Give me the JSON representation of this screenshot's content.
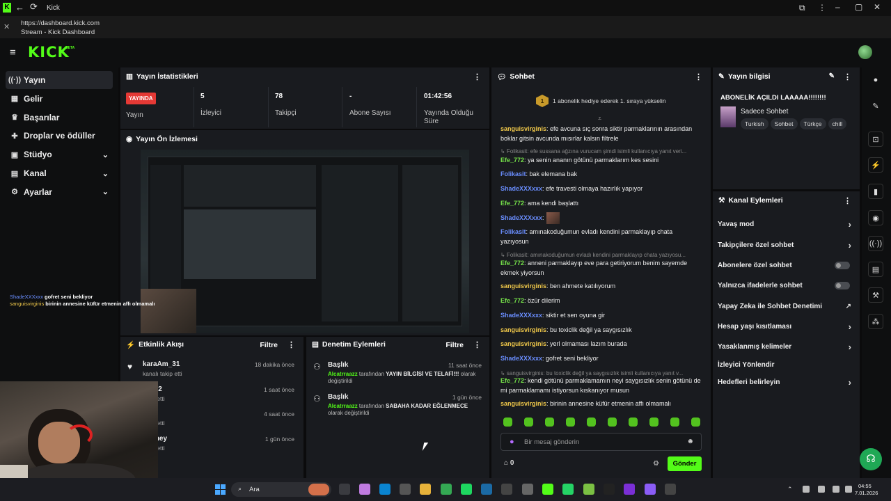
{
  "window": {
    "title": "Kick"
  },
  "urlbar": {
    "url": "https://dashboard.kick.com",
    "page_title": "Stream - Kick Dashboard"
  },
  "app": {
    "logo": "KICK",
    "logo_sup": "BETA"
  },
  "nav": [
    {
      "label": "Yayın",
      "icon": "broadcast-icon",
      "glyph": "((·))"
    },
    {
      "label": "Gelir",
      "icon": "revenue-icon",
      "glyph": "▦"
    },
    {
      "label": "Başarılar",
      "icon": "trophy-icon",
      "glyph": "♛"
    },
    {
      "label": "Droplar ve ödüller",
      "icon": "gift-icon",
      "glyph": "✚"
    },
    {
      "label": "Stüdyo",
      "icon": "studio-icon",
      "glyph": "▣",
      "chevron": "⌄"
    },
    {
      "label": "Kanal",
      "icon": "channel-icon",
      "glyph": "▤",
      "chevron": "⌄"
    },
    {
      "label": "Ayarlar",
      "icon": "settings-icon",
      "glyph": "⚙",
      "chevron": "⌄"
    }
  ],
  "stats": {
    "title": "Yayın İstatistikleri",
    "live_badge": "YAYINDA",
    "items": [
      {
        "value": "",
        "label": "Yayın"
      },
      {
        "value": "5",
        "label": "İzleyici"
      },
      {
        "value": "78",
        "label": "Takipçi"
      },
      {
        "value": "-",
        "label": "Abone Sayısı"
      },
      {
        "value": "01:42:56",
        "label": "Yayında Olduğu Süre"
      }
    ]
  },
  "preview": {
    "title": "Yayın Ön İzlemesi"
  },
  "overlay_chat": [
    {
      "user": "ShadeXXXxxx",
      "msg": "gofret seni bekliyor"
    },
    {
      "user": "sanguisvirginis",
      "msg": "birinin annesine küfür etmenin affı olmamalı"
    }
  ],
  "activity": {
    "title": "Etkinlik Akışı",
    "filter": "Filtre",
    "items": [
      {
        "name": "karaAm_31",
        "sub": "kanalı takip etti",
        "time": "18 dakika önce"
      },
      {
        "name": "p2112",
        "sub": "takip etti",
        "time": "1 saat önce"
      },
      {
        "name": "walti",
        "sub": "takip etti",
        "time": "4 saat önce"
      },
      {
        "name": "ommey",
        "sub": "takip etti",
        "time": "1 gün önce"
      }
    ]
  },
  "moderation": {
    "title": "Denetim Eylemleri",
    "filter": "Filtre",
    "items": [
      {
        "title": "Başlık",
        "actor": "Alcatrraazz",
        "mid": " tarafından ",
        "bold": "YAYIN BİLGİSİ VE TELAFİ!!!",
        "tail": " olarak değiştirildi",
        "time": "11 saat önce"
      },
      {
        "title": "Başlık",
        "actor": "Alcatrraazz",
        "mid": " tarafından ",
        "bold": "SABAHA KADAR EĞLENMECE",
        "tail": " olarak değiştirildi",
        "time": "1 gün önce"
      }
    ]
  },
  "chat": {
    "title": "Sohbet",
    "gift_banner": "1 abonelik hediye ederek 1. sıraya yükselin",
    "gift_rank": "1",
    "messages": [
      {
        "user": "sanguisvirginis",
        "color": "yel",
        "text": ": efe avcuna sıç sonra siktir parmaklarının arasından boklar gitsin avcunda mısırlar kalsın filtrele"
      },
      {
        "sys": "↳ Folikasit: efe sussana ağzına vurucam şimdi isimli kullanıcıya yanıt veri..."
      },
      {
        "user": "Efe_772",
        "color": "green",
        "text": ": ya senin ananın götünü parmaklarım kes sesini"
      },
      {
        "user": "Folikasit",
        "color": "blue",
        "text": ": bak elemana bak"
      },
      {
        "user": "ShadeXXXxxx",
        "color": "blue",
        "text": ": efe travesti olmaya hazırlık yapıyor"
      },
      {
        "user": "Efe_772",
        "color": "green",
        "text": ": ama kendi başlattı"
      },
      {
        "user": "ShadeXXXxxx",
        "color": "blue",
        "text": ":",
        "emote": true
      },
      {
        "user": "Folikasit",
        "color": "blue",
        "text": ": amınakoduğumun evladı kendini parmaklayıp chata yazıyosun"
      },
      {
        "sys": "↳ Folikasit: amınakoduğumun evladı kendini parmaklayıp chata yazıyosu..."
      },
      {
        "user": "Efe_772",
        "color": "green",
        "text": ": anneni parmaklayıp eve para getiriyorum benim sayemde ekmek yiyorsun"
      },
      {
        "user": "sanguisvirginis",
        "color": "yel",
        "text": ": ben ahmete katılıyorum"
      },
      {
        "user": "Efe_772",
        "color": "green",
        "text": ": özür dilerim"
      },
      {
        "user": "ShadeXXXxxx",
        "color": "blue",
        "text": ": siktir et sen oyuna gir"
      },
      {
        "user": "sanguisvirginis",
        "color": "yel",
        "text": ": bu toxiclik değil ya saygısızlık"
      },
      {
        "user": "sanguisvirginis",
        "color": "yel",
        "text": ": yerl olmaması lazım burada"
      },
      {
        "user": "ShadeXXXxxx",
        "color": "blue",
        "text": ": gofret seni bekliyor"
      },
      {
        "sys": "↳ sanguisvirginis: bu toxiclik değil ya saygısızlık isimli kullanıcıya yanıt v..."
      },
      {
        "user": "Efe_772",
        "color": "green",
        "text": ": kendi götünü parmaklamamın neyi saygısızlık senin götünü de mi parmaklamamı istiyorsun kıskanıyor musun"
      },
      {
        "user": "sanguisvirginis",
        "color": "yel",
        "text": ": birinin annesine küfür etmenin affı olmamalı"
      }
    ],
    "input_placeholder": "Bir mesaj gönderin",
    "points": "0",
    "send": "Gönder"
  },
  "stream_info": {
    "title": "Yayın bilgisi",
    "stream_title": "ABONELİK AÇILDI LAAAAA!!!!!!!!",
    "category": "Sadece Sohbet",
    "tags": [
      "Turkish",
      "Sohbet",
      "Türkçe",
      "chill"
    ]
  },
  "channel_actions": {
    "title": "Kanal Eylemleri",
    "items": [
      {
        "label": "Yavaş mod",
        "kind": "chevron"
      },
      {
        "label": "Takipçilere özel sohbet",
        "kind": "chevron"
      },
      {
        "label": "Abonelere özel sohbet",
        "kind": "toggle"
      },
      {
        "label": "Yalnızca ifadelerle sohbet",
        "kind": "toggle"
      },
      {
        "label": "Yapay Zeka ile Sohbet Denetimi",
        "kind": "external"
      },
      {
        "label": "Hesap yaşı kısıtlaması",
        "kind": "chevron"
      },
      {
        "label": "Yasaklanmış kelimeler",
        "kind": "chevron"
      },
      {
        "label": "İzleyici Yönlendir",
        "kind": "none"
      },
      {
        "label": "Hedefleri belirleyin",
        "kind": "chevron"
      }
    ]
  },
  "taskbar": {
    "search": "Ara",
    "time": "04:55",
    "date": "7.01.2026"
  },
  "colors": {
    "accent": "#53fc18",
    "bg": "#0b0b0c",
    "panel": "#191b1f",
    "live": "#e53935"
  }
}
